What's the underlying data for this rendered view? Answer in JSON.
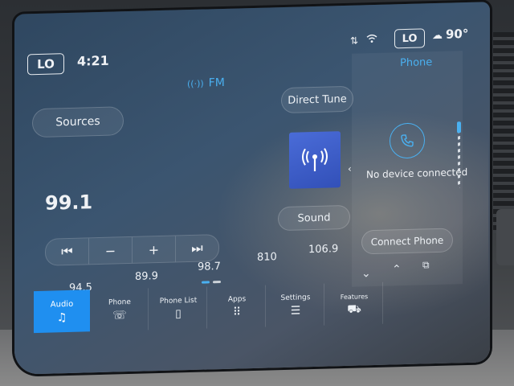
{
  "status_bar": {
    "left_temp": "LO",
    "time": "4:21",
    "right_temp": "LO",
    "outside_temp": "90°"
  },
  "radio": {
    "band_label": "FM",
    "current_frequency": "99.1",
    "sources_label": "Sources",
    "direct_tune_label": "Direct Tune",
    "sound_label": "Sound",
    "seek_controls": [
      "⏮",
      "−",
      "+",
      "⏭"
    ],
    "presets": [
      "94.5",
      "89.9",
      "98.7",
      "810",
      "106.9"
    ]
  },
  "phone_panel": {
    "title": "Phone",
    "status": "No device connected",
    "connect_label": "Connect Phone"
  },
  "tabs": [
    {
      "label": "Audio",
      "icon": "music-note-icon",
      "active": true
    },
    {
      "label": "Phone",
      "icon": "phone-icon",
      "active": false
    },
    {
      "label": "Phone List",
      "icon": "phone-list-icon",
      "active": false
    },
    {
      "label": "Apps",
      "icon": "apps-grid-icon",
      "active": false
    },
    {
      "label": "Settings",
      "icon": "settings-sliders-icon",
      "active": false
    },
    {
      "label": "Features",
      "icon": "car-features-icon",
      "active": false
    }
  ],
  "colors": {
    "accent": "#1f8ff0",
    "highlight_text": "#4ab0f0",
    "radio_tile": "#3f5fd0"
  }
}
